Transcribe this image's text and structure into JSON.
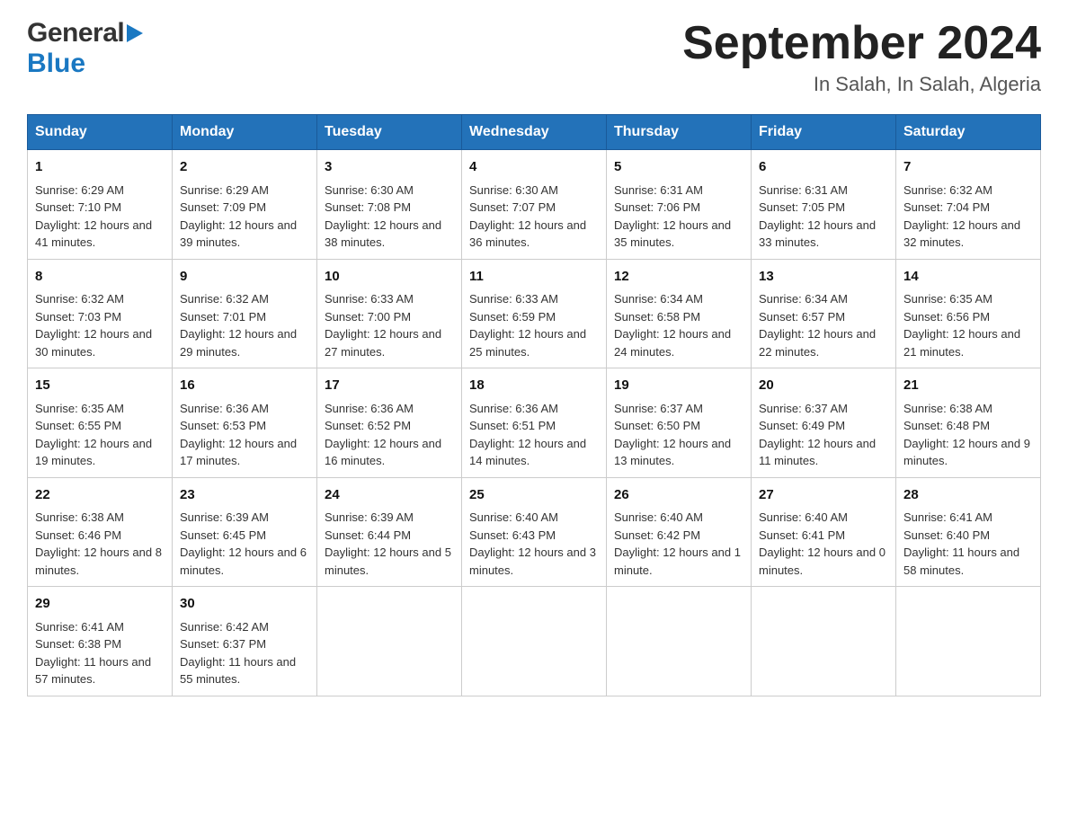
{
  "header": {
    "logo_general": "General",
    "logo_blue": "Blue",
    "title": "September 2024",
    "subtitle": "In Salah, In Salah, Algeria"
  },
  "calendar": {
    "days_of_week": [
      "Sunday",
      "Monday",
      "Tuesday",
      "Wednesday",
      "Thursday",
      "Friday",
      "Saturday"
    ],
    "weeks": [
      [
        {
          "day": "1",
          "sunrise": "6:29 AM",
          "sunset": "7:10 PM",
          "daylight": "12 hours and 41 minutes."
        },
        {
          "day": "2",
          "sunrise": "6:29 AM",
          "sunset": "7:09 PM",
          "daylight": "12 hours and 39 minutes."
        },
        {
          "day": "3",
          "sunrise": "6:30 AM",
          "sunset": "7:08 PM",
          "daylight": "12 hours and 38 minutes."
        },
        {
          "day": "4",
          "sunrise": "6:30 AM",
          "sunset": "7:07 PM",
          "daylight": "12 hours and 36 minutes."
        },
        {
          "day": "5",
          "sunrise": "6:31 AM",
          "sunset": "7:06 PM",
          "daylight": "12 hours and 35 minutes."
        },
        {
          "day": "6",
          "sunrise": "6:31 AM",
          "sunset": "7:05 PM",
          "daylight": "12 hours and 33 minutes."
        },
        {
          "day": "7",
          "sunrise": "6:32 AM",
          "sunset": "7:04 PM",
          "daylight": "12 hours and 32 minutes."
        }
      ],
      [
        {
          "day": "8",
          "sunrise": "6:32 AM",
          "sunset": "7:03 PM",
          "daylight": "12 hours and 30 minutes."
        },
        {
          "day": "9",
          "sunrise": "6:32 AM",
          "sunset": "7:01 PM",
          "daylight": "12 hours and 29 minutes."
        },
        {
          "day": "10",
          "sunrise": "6:33 AM",
          "sunset": "7:00 PM",
          "daylight": "12 hours and 27 minutes."
        },
        {
          "day": "11",
          "sunrise": "6:33 AM",
          "sunset": "6:59 PM",
          "daylight": "12 hours and 25 minutes."
        },
        {
          "day": "12",
          "sunrise": "6:34 AM",
          "sunset": "6:58 PM",
          "daylight": "12 hours and 24 minutes."
        },
        {
          "day": "13",
          "sunrise": "6:34 AM",
          "sunset": "6:57 PM",
          "daylight": "12 hours and 22 minutes."
        },
        {
          "day": "14",
          "sunrise": "6:35 AM",
          "sunset": "6:56 PM",
          "daylight": "12 hours and 21 minutes."
        }
      ],
      [
        {
          "day": "15",
          "sunrise": "6:35 AM",
          "sunset": "6:55 PM",
          "daylight": "12 hours and 19 minutes."
        },
        {
          "day": "16",
          "sunrise": "6:36 AM",
          "sunset": "6:53 PM",
          "daylight": "12 hours and 17 minutes."
        },
        {
          "day": "17",
          "sunrise": "6:36 AM",
          "sunset": "6:52 PM",
          "daylight": "12 hours and 16 minutes."
        },
        {
          "day": "18",
          "sunrise": "6:36 AM",
          "sunset": "6:51 PM",
          "daylight": "12 hours and 14 minutes."
        },
        {
          "day": "19",
          "sunrise": "6:37 AM",
          "sunset": "6:50 PM",
          "daylight": "12 hours and 13 minutes."
        },
        {
          "day": "20",
          "sunrise": "6:37 AM",
          "sunset": "6:49 PM",
          "daylight": "12 hours and 11 minutes."
        },
        {
          "day": "21",
          "sunrise": "6:38 AM",
          "sunset": "6:48 PM",
          "daylight": "12 hours and 9 minutes."
        }
      ],
      [
        {
          "day": "22",
          "sunrise": "6:38 AM",
          "sunset": "6:46 PM",
          "daylight": "12 hours and 8 minutes."
        },
        {
          "day": "23",
          "sunrise": "6:39 AM",
          "sunset": "6:45 PM",
          "daylight": "12 hours and 6 minutes."
        },
        {
          "day": "24",
          "sunrise": "6:39 AM",
          "sunset": "6:44 PM",
          "daylight": "12 hours and 5 minutes."
        },
        {
          "day": "25",
          "sunrise": "6:40 AM",
          "sunset": "6:43 PM",
          "daylight": "12 hours and 3 minutes."
        },
        {
          "day": "26",
          "sunrise": "6:40 AM",
          "sunset": "6:42 PM",
          "daylight": "12 hours and 1 minute."
        },
        {
          "day": "27",
          "sunrise": "6:40 AM",
          "sunset": "6:41 PM",
          "daylight": "12 hours and 0 minutes."
        },
        {
          "day": "28",
          "sunrise": "6:41 AM",
          "sunset": "6:40 PM",
          "daylight": "11 hours and 58 minutes."
        }
      ],
      [
        {
          "day": "29",
          "sunrise": "6:41 AM",
          "sunset": "6:38 PM",
          "daylight": "11 hours and 57 minutes."
        },
        {
          "day": "30",
          "sunrise": "6:42 AM",
          "sunset": "6:37 PM",
          "daylight": "11 hours and 55 minutes."
        },
        null,
        null,
        null,
        null,
        null
      ]
    ]
  }
}
